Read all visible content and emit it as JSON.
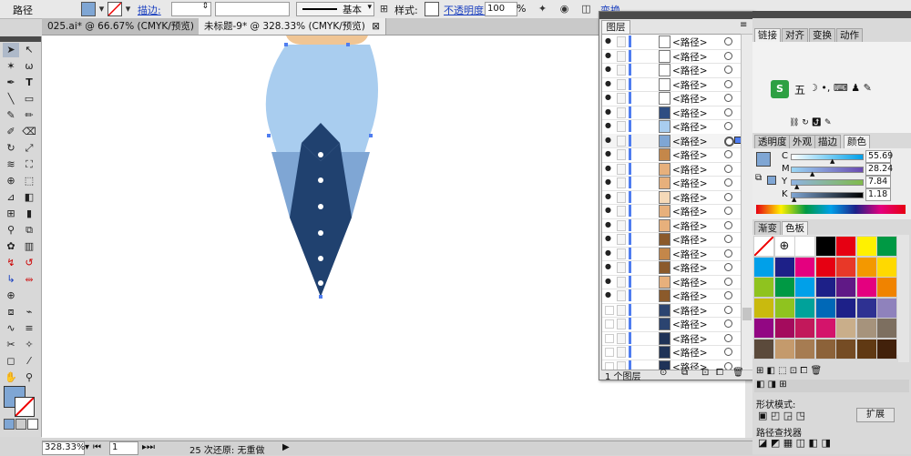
{
  "control_bar": {
    "object_type": "路径",
    "stroke_label": "描边:",
    "stroke_style": "基本",
    "style_label": "样式:",
    "opacity_label": "不透明度:",
    "opacity_value": "100",
    "percent": "%",
    "transform_label": "变换",
    "fill_color": "#7fa6d4"
  },
  "doc_tabs": [
    {
      "label": "025.ai* @ 66.67% (CMYK/预览)",
      "close": "⊠"
    },
    {
      "label": "未标题-9* @ 328.33% (CMYK/预览)",
      "close": "⊠"
    }
  ],
  "tools": {
    "fill_color": "#7fa6d4"
  },
  "status_bar": {
    "zoom": "328.33%",
    "page": "1",
    "undo_text": "25 次还原: 无重做"
  },
  "layers_panel": {
    "tab": "图层",
    "item_label": "<路径>",
    "footer_count": "1 个图层",
    "rows": [
      {
        "name": "<路径>",
        "visible": true,
        "thumb": "#ffffff"
      },
      {
        "name": "<路径>",
        "visible": true,
        "thumb": "#ffffff"
      },
      {
        "name": "<路径>",
        "visible": true,
        "thumb": "#ffffff"
      },
      {
        "name": "<路径>",
        "visible": true,
        "thumb": "#ffffff"
      },
      {
        "name": "<路径>",
        "visible": true,
        "thumb": "#ffffff"
      },
      {
        "name": "<路径>",
        "visible": true,
        "thumb": "#2e4d82"
      },
      {
        "name": "<路径>",
        "visible": true,
        "thumb": "#a9cdef"
      },
      {
        "name": "<路径>",
        "visible": true,
        "thumb": "#7fa6d4",
        "selected": true
      },
      {
        "name": "<路径>",
        "visible": true,
        "thumb": "#c4874a"
      },
      {
        "name": "<路径>",
        "visible": true,
        "thumb": "#e7b07c"
      },
      {
        "name": "<路径>",
        "visible": true,
        "thumb": "#e7b07c"
      },
      {
        "name": "<路径>",
        "visible": true,
        "thumb": "#f5d9b8"
      },
      {
        "name": "<路径>",
        "visible": true,
        "thumb": "#e7b07c"
      },
      {
        "name": "<路径>",
        "visible": true,
        "thumb": "#e7b07c"
      },
      {
        "name": "<路径>",
        "visible": true,
        "thumb": "#8b5a2b"
      },
      {
        "name": "<路径>",
        "visible": true,
        "thumb": "#c4874a"
      },
      {
        "name": "<路径>",
        "visible": true,
        "thumb": "#8b5a2b"
      },
      {
        "name": "<路径>",
        "visible": true,
        "thumb": "#e7b07c"
      },
      {
        "name": "<路径>",
        "visible": true,
        "thumb": "#8b5a2b"
      },
      {
        "name": "<路径>",
        "visible": false,
        "thumb": "#2b4470"
      },
      {
        "name": "<路径>",
        "visible": false,
        "thumb": "#2b4470"
      },
      {
        "name": "<路径>",
        "visible": false,
        "thumb": "#1f3358"
      },
      {
        "name": "<路径>",
        "visible": false,
        "thumb": "#1f3358"
      },
      {
        "name": "<路径>",
        "visible": false,
        "thumb": "#1f3358"
      }
    ]
  },
  "right_panels": {
    "top_tabs": [
      "链接",
      "对齐",
      "变换",
      "动作"
    ],
    "color_tabs": [
      "透明度",
      "外观",
      "描边",
      "颜色"
    ],
    "cmyk": [
      {
        "label": "C",
        "value": "55.69",
        "fraction": 0.5569
      },
      {
        "label": "M",
        "value": "28.24",
        "fraction": 0.2824
      },
      {
        "label": "Y",
        "value": "7.84",
        "fraction": 0.0784
      },
      {
        "label": "K",
        "value": "1.18",
        "fraction": 0.0118
      }
    ],
    "swatch_tabs": [
      "渐变",
      "色板"
    ],
    "bottom_label": "路径查找器",
    "extend_button": "扩展",
    "shapes_label": "形状模式:",
    "ime_text": "五"
  },
  "swatches": [
    "#ffffff",
    "#ffffff",
    "#ffffff",
    "#000000",
    "#e60012",
    "#fff100",
    "#009944",
    "#00a0e9",
    "#1d2088",
    "#e4007f",
    "#e60012",
    "#e83828",
    "#f39800",
    "#ffd900",
    "#8fc31f",
    "#009944",
    "#00a0e9",
    "#1d2088",
    "#601986",
    "#e4007f",
    "#f08300",
    "#c9ba0e",
    "#8fc31f",
    "#00a29a",
    "#0068b7",
    "#1d2088",
    "#2e3192",
    "#8f82bc",
    "#920783",
    "#a40b5d",
    "#c2185b",
    "#d4146b",
    "#c9ae8a",
    "#a6937c",
    "#7d6f60",
    "#5b4a3b",
    "#c49a6c",
    "#a67c52",
    "#8c6239",
    "#754c24",
    "#603913",
    "#42210b"
  ],
  "colors": {
    "tie_outer": "#a9cdef",
    "tie_mid": "#7fa6d4",
    "tie_dark": "#20416f",
    "skin": "#f0c594",
    "accent_blue": "#4f7df0"
  }
}
